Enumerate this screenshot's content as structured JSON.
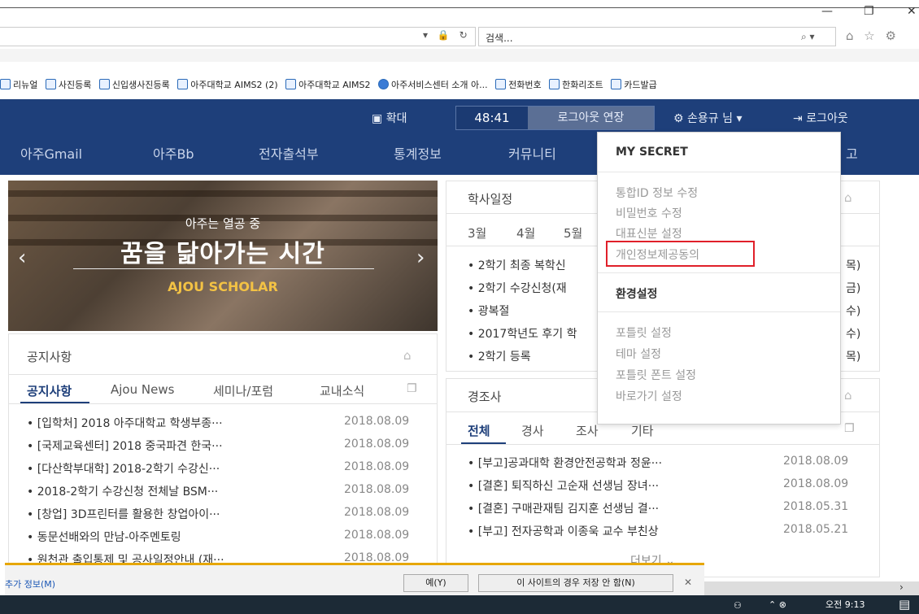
{
  "browser": {
    "search_placeholder": "검색...",
    "win_controls": [
      "—",
      "❐",
      "✕"
    ],
    "favorites": [
      {
        "label": "리뉴얼",
        "icon": "ie-page-icon"
      },
      {
        "label": "사진등록",
        "icon": "ie-page-icon"
      },
      {
        "label": "신입생사진등록",
        "icon": "ie-page-icon"
      },
      {
        "label": "아주대학교 AIMS2 (2)",
        "icon": "ie-page-icon"
      },
      {
        "label": "아주대학교 AIMS2",
        "icon": "ie-page-icon"
      },
      {
        "label": "아주서비스센터 소개  아...",
        "icon": "globe-icon"
      },
      {
        "label": "전화번호",
        "icon": "ie-page-icon"
      },
      {
        "label": "한화리조트",
        "icon": "ie-page-icon"
      },
      {
        "label": "카드발급",
        "icon": "ie-page-icon"
      }
    ]
  },
  "header": {
    "zoom_label": "확대",
    "timer": "48:41",
    "extend_label": "로그아웃 연장",
    "user_label": "손용규 님",
    "logout_label": "로그아웃",
    "nav": [
      "아주Gmail",
      "아주Bb",
      "전자출석부",
      "통계정보",
      "커뮤니티",
      "고"
    ]
  },
  "banner": {
    "small": "아주는 열공 중",
    "big": "꿈을 닮아가는 시간",
    "sub": "AJOU SCHOLAR"
  },
  "schedule": {
    "title": "학사일정",
    "months": [
      "3월",
      "4월",
      "5월"
    ],
    "items": [
      {
        "text": "• 2학기 최종 복학신",
        "day": "목)"
      },
      {
        "text": "• 2학기 수강신청(재",
        "day": "금)"
      },
      {
        "text": "• 광복절",
        "day": "수)"
      },
      {
        "text": "• 2017학년도 후기 학",
        "day": "수)"
      },
      {
        "text": "• 2학기 등록",
        "day": "목)"
      }
    ]
  },
  "notice": {
    "title": "공지사항",
    "tabs": [
      "공지사항",
      "Ajou News",
      "세미나/포럼",
      "교내소식"
    ],
    "items": [
      {
        "text": "• [입학처] 2018 아주대학교 학생부종···",
        "date": "2018.08.09"
      },
      {
        "text": "• [국제교육센터] 2018 중국파견 한국···",
        "date": "2018.08.09"
      },
      {
        "text": "• [다산학부대학] 2018-2학기 수강신···",
        "date": "2018.08.09"
      },
      {
        "text": "• 2018-2학기 수강신청 전체날 BSM···",
        "date": "2018.08.09"
      },
      {
        "text": "• [창업] 3D프린터를 활용한 창업아이···",
        "date": "2018.08.09"
      },
      {
        "text": "• 동문선배와의 만남-아주멘토링",
        "date": "2018.08.09"
      },
      {
        "text": "• 원천관 출입통제 및 공사일정안내 (재···",
        "date": "2018.08.09"
      }
    ]
  },
  "condolence": {
    "title": "경조사",
    "tabs": [
      "전체",
      "경사",
      "조사",
      "기타"
    ],
    "items": [
      {
        "text": "• [부고]공과대학 환경안전공학과 정윤···",
        "date": "2018.08.09"
      },
      {
        "text": "• [결혼] 퇴직하신 고순재 선생님 장녀···",
        "date": "2018.08.09"
      },
      {
        "text": "• [결혼] 구매관재팀 김지훈 선생님 결···",
        "date": "2018.05.31"
      },
      {
        "text": "• [부고] 전자공학과 이종욱 교수 부친상",
        "date": "2018.05.21"
      }
    ],
    "more_label": "더보기"
  },
  "dropdown": {
    "my_secret": "MY SECRET",
    "secret_items": [
      "통합ID 정보 수정",
      "비밀번호 수정",
      "대표신분 설정",
      "개인정보제공동의"
    ],
    "settings_title": "환경설정",
    "settings_items": [
      "포틀릿 설정",
      "테마 설정",
      "포틀릿 폰트 설정",
      "바로가기 설정"
    ]
  },
  "notify": {
    "text": "추가 정보(M)",
    "yes": "예(Y)",
    "never": "이 사이트의 경우 저장 안 함(N)",
    "close": "✕"
  },
  "taskbar": {
    "time": "오전 9:13"
  }
}
